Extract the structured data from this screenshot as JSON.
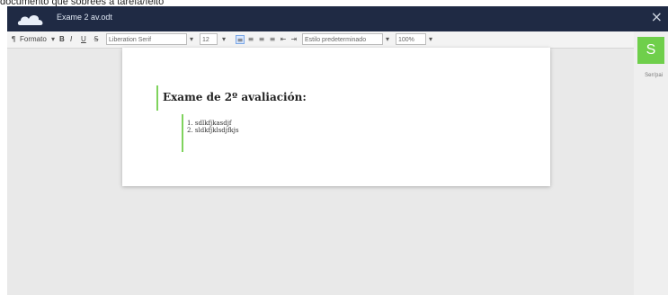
{
  "caption_fragment": "documento que sobrees a tarefa/feito",
  "window": {
    "doc_title": "Exame 2 av.odt",
    "close_glyph": "×"
  },
  "toolbar": {
    "style_label": "Formato",
    "bold": "B",
    "italic": "I",
    "underline": "U",
    "font_family_value": "Liberation Serif",
    "font_size_value": "12",
    "paragraph_style_value": "Estilo predeterminado",
    "zoom_value": "100%"
  },
  "collab": {
    "avatar_letter": "S",
    "avatar_label": "Sen'pai"
  },
  "document": {
    "heading": "Exame de 2º avaliación:",
    "list_items": [
      "1. sdlkfjkasdjf",
      "2. sldkfjklsdjfkjs"
    ]
  },
  "colors": {
    "titlebar": "#1f2a44",
    "avatar": "#6fcf4b",
    "cursor": "#7fd35d"
  }
}
